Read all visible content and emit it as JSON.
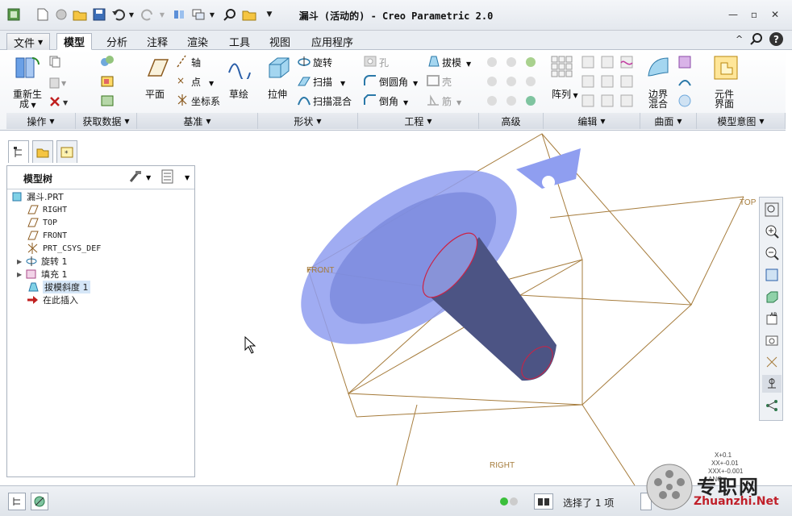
{
  "window": {
    "title": "漏斗 (活动的) - Creo Parametric 2.0"
  },
  "tabs": [
    {
      "label": "文件"
    },
    {
      "label": "模型"
    },
    {
      "label": "分析"
    },
    {
      "label": "注释"
    },
    {
      "label": "渲染"
    },
    {
      "label": "工具"
    },
    {
      "label": "视图"
    },
    {
      "label": "应用程序"
    }
  ],
  "ribbon": {
    "regen_label_1": "重新生",
    "regen_label_2": "成",
    "groups": [
      "操作",
      "获取数据",
      "基准",
      "形状",
      "工程",
      "编辑",
      "曲面",
      "模型意图"
    ],
    "extra_group": "高级",
    "datum": {
      "plane": "平面",
      "axis": "轴",
      "point": "点",
      "csys": "坐标系",
      "sketch": "草绘"
    },
    "shape": {
      "extrude": "拉伸",
      "revolve": "旋转",
      "sweep": "扫描",
      "swept_blend": "扫描混合"
    },
    "engineering": {
      "hole": "孔",
      "round": "倒圆角",
      "chamfer": "倒角",
      "draft": "拔模",
      "shell": "壳",
      "rib": "筋"
    },
    "edit": {
      "pattern": "阵列"
    },
    "surface": {
      "boundary_blend_1": "边界",
      "boundary_blend_2": "混合"
    },
    "intent": {
      "component_interface_1": "元件",
      "component_interface_2": "界面"
    }
  },
  "model_tree": {
    "title": "模型树",
    "items": [
      {
        "label": "漏斗.PRT"
      },
      {
        "label": "RIGHT"
      },
      {
        "label": "TOP"
      },
      {
        "label": "FRONT"
      },
      {
        "label": "PRT_CSYS_DEF"
      },
      {
        "label": "旋转 1"
      },
      {
        "label": "填充 1"
      },
      {
        "label": "拔模斜度 1"
      },
      {
        "label": "在此插入"
      }
    ]
  },
  "viewport": {
    "datum_labels": {
      "top": "TOP",
      "front": "FRONT",
      "right": "RIGHT"
    },
    "triad": {
      "x": "X+0.1",
      "xx": "XX+-0.01",
      "xxx": "XXX+-0.001",
      "ang": "ANG"
    }
  },
  "status": {
    "selection": "选择了 1 项"
  },
  "watermark": {
    "brand": "专职网",
    "url": "Zhuanzhi.Net"
  },
  "colors": {
    "funnel_light": "#8f9ef0",
    "funnel_dark": "#4c5484",
    "datum_edge": "#a67c3c",
    "highlight": "#cc2244"
  }
}
